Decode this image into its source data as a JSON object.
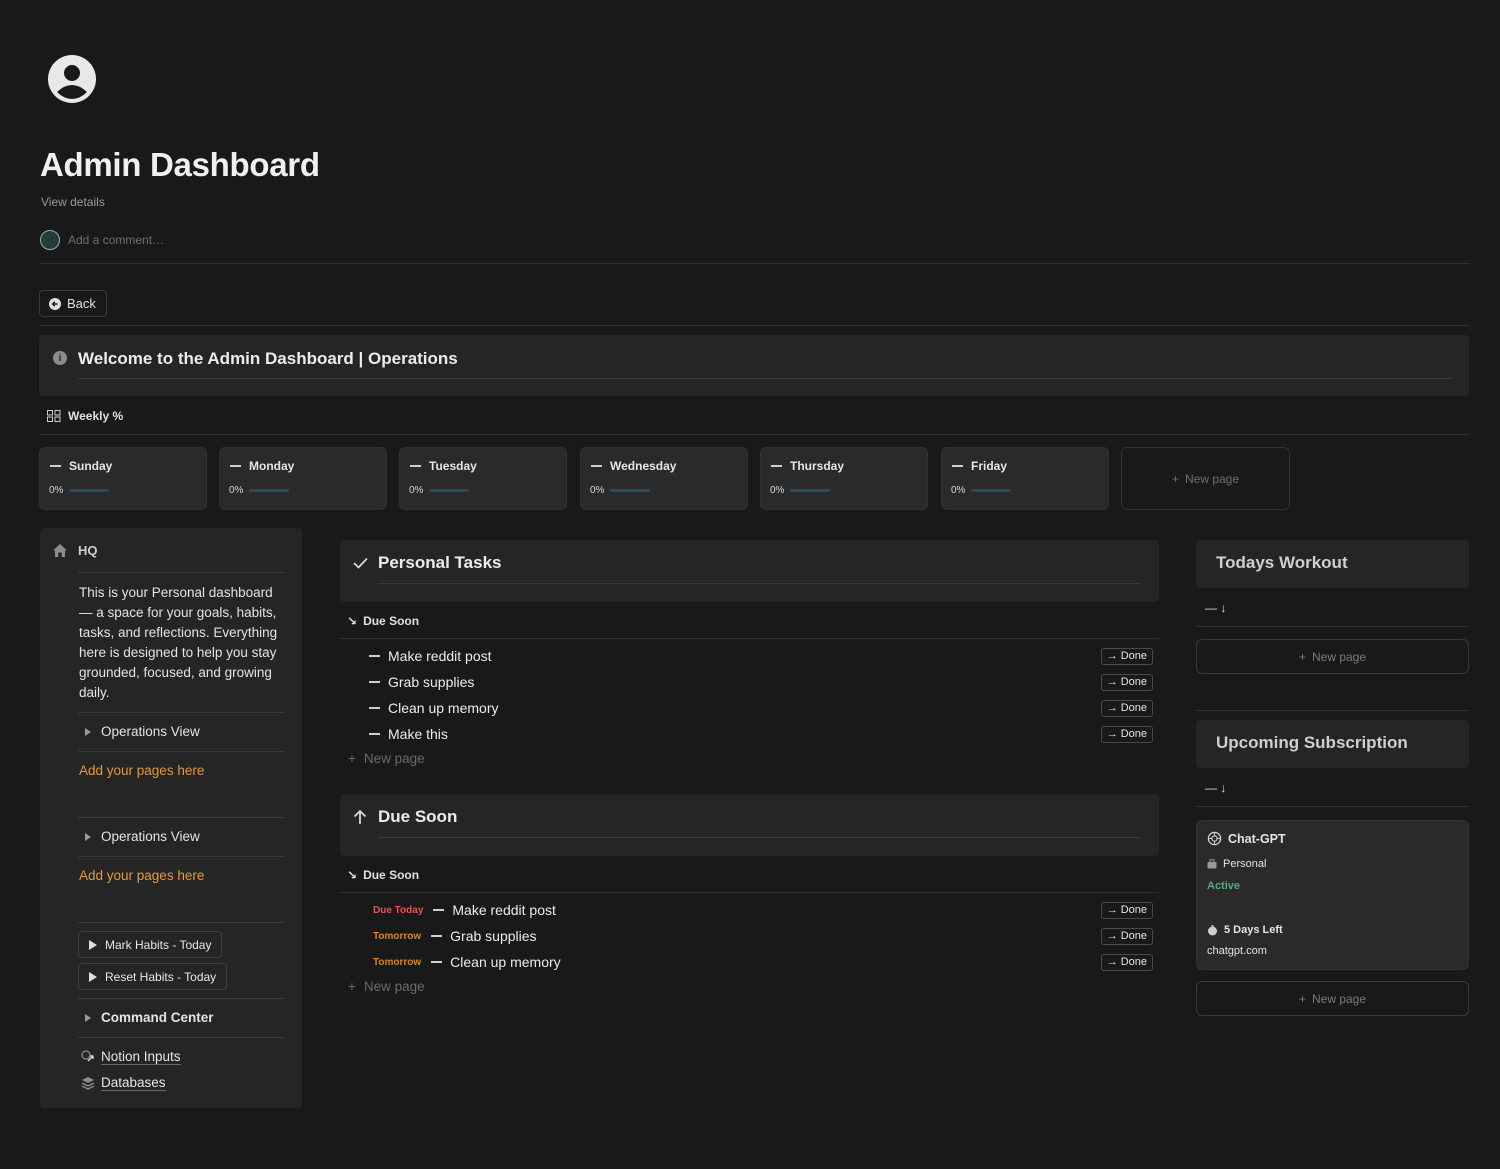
{
  "page": {
    "title": "Admin Dashboard",
    "view_details": "View details",
    "comment_placeholder": "Add a comment…"
  },
  "back_button": {
    "label": "Back"
  },
  "callout": {
    "title": "Welcome to the Admin Dashboard | Operations"
  },
  "weekly": {
    "tab_label": "Weekly %",
    "days": [
      {
        "name": "Sunday",
        "percent_label": "0%",
        "percent": 0
      },
      {
        "name": "Monday",
        "percent_label": "0%",
        "percent": 0
      },
      {
        "name": "Tuesday",
        "percent_label": "0%",
        "percent": 0
      },
      {
        "name": "Wednesday",
        "percent_label": "0%",
        "percent": 0
      },
      {
        "name": "Thursday",
        "percent_label": "0%",
        "percent": 0
      },
      {
        "name": "Friday",
        "percent_label": "0%",
        "percent": 0
      }
    ],
    "new_page": "New page"
  },
  "hq": {
    "title": "HQ",
    "description": "This is your Personal dashboard — a space for your goals, habits, tasks, and reflections. Everything here is designed to help you stay grounded, focused, and growing daily.",
    "toggle1": "Operations View",
    "add_pages1": "Add your pages here",
    "toggle2": "Operations View",
    "add_pages2": "Add your pages here",
    "mark_habits": "Mark Habits - Today",
    "reset_habits": "Reset Habits - Today",
    "command_center": "Command Center",
    "notion_inputs": "Notion Inputs",
    "databases": "Databases"
  },
  "personal_tasks": {
    "title": "Personal Tasks",
    "group": "Due Soon",
    "items": [
      "Make reddit post",
      "Grab supplies",
      "Clean up memory",
      "Make this"
    ],
    "done_label": "Done",
    "new_page": "New page"
  },
  "due_soon": {
    "title": "Due Soon",
    "group": "Due Soon",
    "items": [
      {
        "due": "Due Today",
        "due_color": "#e0574f",
        "name": "Make reddit post"
      },
      {
        "due": "Tomorrow",
        "due_color": "#d9822b",
        "name": "Grab supplies"
      },
      {
        "due": "Tomorrow",
        "due_color": "#d9822b",
        "name": "Clean up memory"
      }
    ],
    "done_label": "Done",
    "new_page": "New page"
  },
  "workout": {
    "title": "Todays Workout",
    "sort": "— ↓",
    "new_page": "New page"
  },
  "subscriptions": {
    "title": "Upcoming Subscription",
    "sort": "— ↓",
    "card": {
      "name": "Chat-GPT",
      "category": "Personal",
      "status": "Active",
      "status_color": "#4fae7a",
      "days_left": "5 Days Left",
      "url": "chatgpt.com"
    },
    "new_page": "New page"
  }
}
